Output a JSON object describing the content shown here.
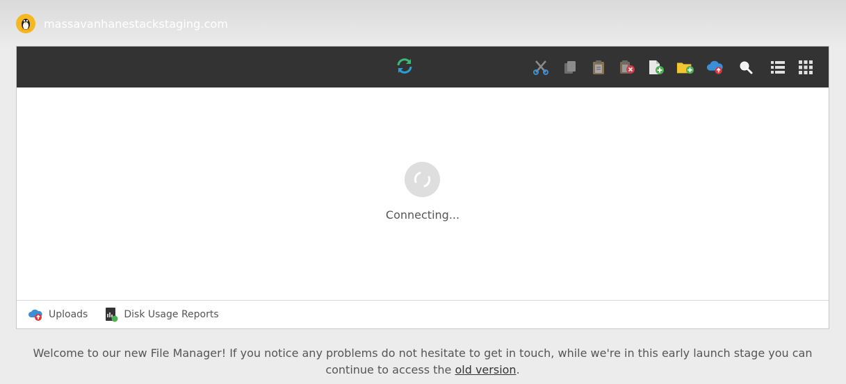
{
  "header": {
    "site_name": "massavanhanestackstaging.com",
    "site_icon": "linux-penguin-icon"
  },
  "toolbar": {
    "refresh_icon": "refresh-icon",
    "buttons": [
      {
        "name": "cut",
        "icon": "scissors-icon"
      },
      {
        "name": "copy",
        "icon": "copy-icon"
      },
      {
        "name": "paste",
        "icon": "clipboard-icon"
      },
      {
        "name": "delete",
        "icon": "delete-icon"
      },
      {
        "name": "new-file",
        "icon": "new-file-icon"
      },
      {
        "name": "new-folder",
        "icon": "new-folder-icon"
      },
      {
        "name": "upload",
        "icon": "cloud-upload-icon"
      },
      {
        "name": "search",
        "icon": "search-icon"
      },
      {
        "name": "list-view",
        "icon": "list-view-icon"
      },
      {
        "name": "grid-view",
        "icon": "grid-view-icon"
      }
    ]
  },
  "main": {
    "status_text": "Connecting..."
  },
  "footer": {
    "uploads_label": "Uploads",
    "disk_usage_label": "Disk Usage Reports"
  },
  "notice": {
    "text": "Welcome to our new File Manager! If you notice any problems do not hesitate to get in touch, while we're in this early launch stage you can continue to access the",
    "link_text": "old version",
    "suffix": "."
  },
  "colors": {
    "toolbar_bg": "#333333",
    "site_icon_bg": "#f5b820",
    "refresh_green": "#3cb878",
    "refresh_blue": "#2a9fd6",
    "folder_yellow": "#f2c531",
    "plus_green": "#4caf50",
    "cloud_blue": "#3a8fd9",
    "upload_red": "#e0343a"
  }
}
